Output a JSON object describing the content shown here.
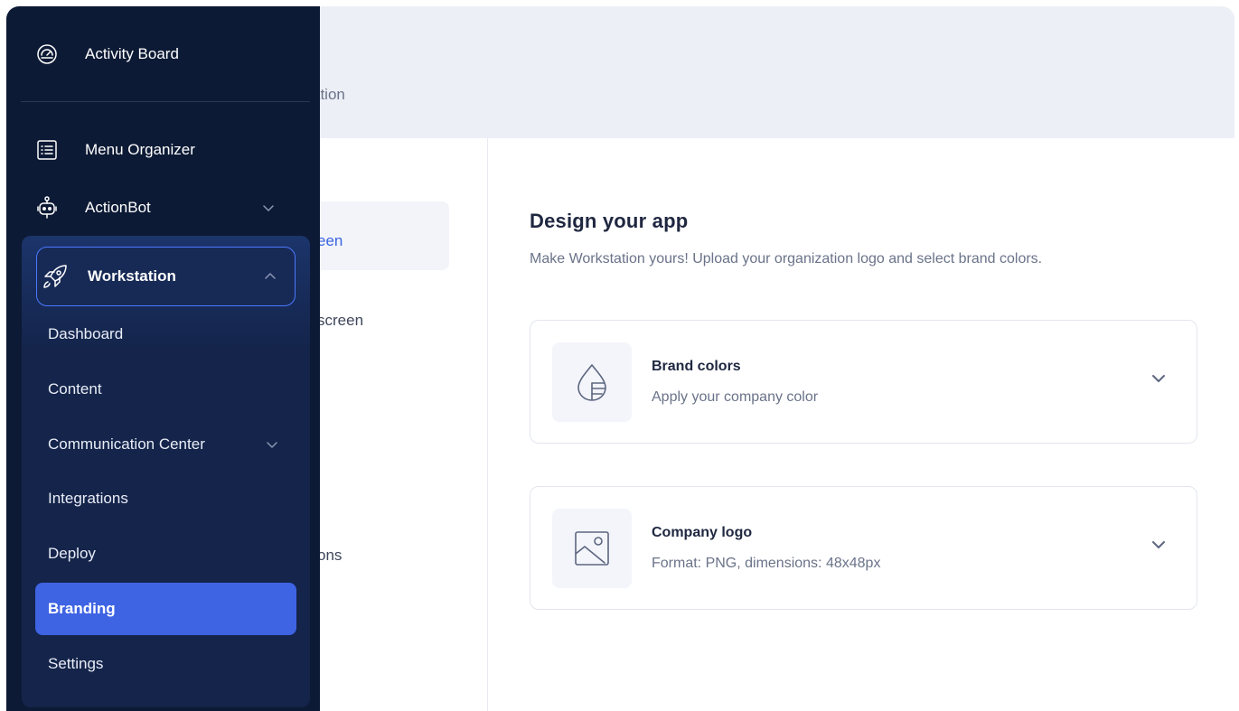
{
  "header": {
    "text": "ation"
  },
  "tabs": {
    "items": [
      {
        "label": "een"
      },
      {
        "label": "screen"
      },
      {
        "label": "ons"
      }
    ]
  },
  "content": {
    "title": "Design your app",
    "subtitle": "Make Workstation yours! Upload your organization logo and select brand colors.",
    "cards": [
      {
        "title": "Brand colors",
        "desc": "Apply your company color",
        "icon": "droplet-icon"
      },
      {
        "title": "Company logo",
        "desc": "Format: PNG, dimensions: 48x48px",
        "icon": "image-icon"
      }
    ]
  },
  "sidebar": {
    "items": [
      {
        "label": "Activity Board",
        "icon": "gauge-icon"
      },
      {
        "label": "Menu Organizer",
        "icon": "list-icon"
      },
      {
        "label": "ActionBot",
        "icon": "robot-icon"
      }
    ],
    "workstation": {
      "label": "Workstation",
      "icon": "rocket-icon",
      "children": [
        {
          "label": "Dashboard"
        },
        {
          "label": "Content"
        },
        {
          "label": "Communication Center"
        },
        {
          "label": "Integrations"
        },
        {
          "label": "Deploy"
        },
        {
          "label": "Branding"
        },
        {
          "label": "Settings"
        }
      ]
    }
  },
  "colors": {
    "sidebar_bg": "#0d1a35",
    "workstation_panel": "#14244a",
    "accent": "#3e63e3",
    "highlight_border": "#4b78ff",
    "header_bg": "#eceff6"
  }
}
